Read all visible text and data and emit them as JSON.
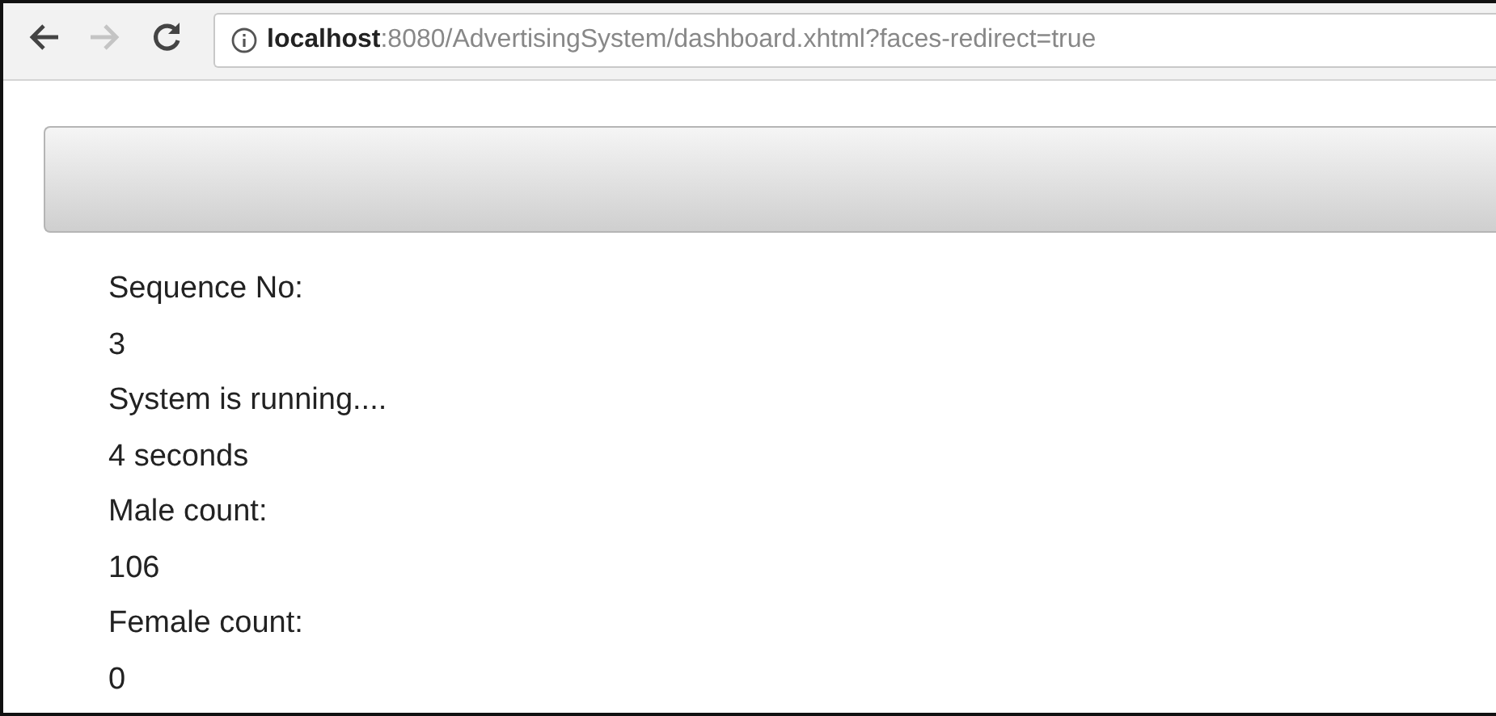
{
  "browser": {
    "back_enabled": true,
    "forward_enabled": false,
    "url_host": "localhost",
    "url_rest": ":8080/AdvertisingSystem/dashboard.xhtml?faces-redirect=true"
  },
  "lines": [
    {
      "text": "Sequence No:"
    },
    {
      "text": "3"
    },
    {
      "text": "System is running...."
    },
    {
      "text": "4 seconds"
    },
    {
      "text": "Male count:"
    },
    {
      "text": "106"
    },
    {
      "text": "Female count:"
    },
    {
      "text": "0"
    }
  ]
}
